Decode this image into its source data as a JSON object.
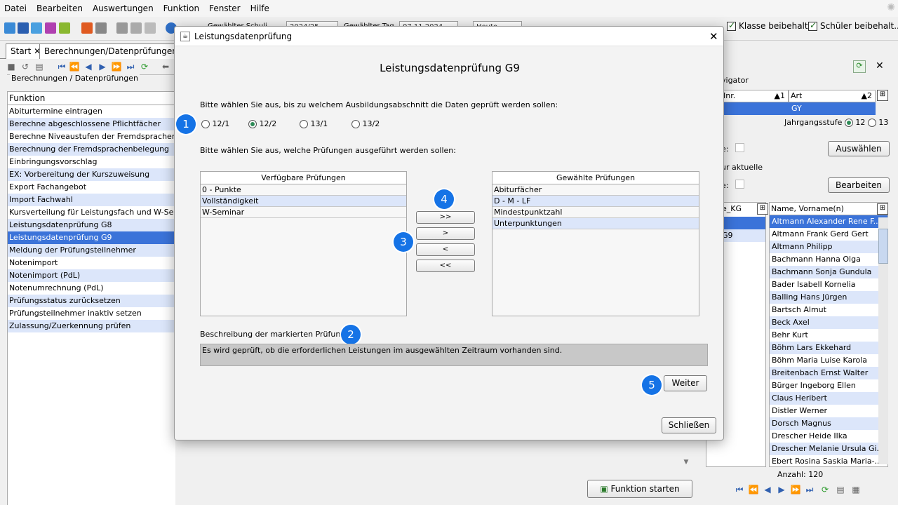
{
  "menu": [
    "Datei",
    "Bearbeiten",
    "Auswertungen",
    "Funktion",
    "Fenster",
    "Hilfe"
  ],
  "toolbar": {
    "schule_label": "Gewählter Schuli...",
    "schuljahr": "2024/25",
    "tag_label": "Gewählter Tag",
    "tag": "07.11.2024",
    "heute": "Heute",
    "klasse_beibehalten": "Klasse beibehalt...",
    "schueler_beibehalten": "Schüler beibehalt..."
  },
  "tabs": {
    "start": "Start",
    "berechnungen": "Berechnungen/Datenprüfungen"
  },
  "left": {
    "group_title": "Berechnungen / Datenprüfungen",
    "col_header": "Funktion",
    "items": [
      "Abiturtermine eintragen",
      "Berechne abgeschlossene Pflichtfächer",
      "Berechne Niveaustufen der Fremdsprachen",
      "Berechnung der Fremdsprachenbelegung",
      "Einbringungsvorschlag",
      "EX: Vorbereitung der Kurszuweisung",
      "Export Fachangebot",
      "Import Fachwahl",
      "Kursverteilung für Leistungsfach und W-Semin",
      "Leistungsdatenprüfung G8",
      "Leistungsdatenprüfung G9",
      "Meldung der Prüfungsteilnehmer",
      "Notenimport",
      "Notenimport (PdL)",
      "Notenumrechnung (PdL)",
      "Prüfungsstatus zurücksetzen",
      "Prüfungsteilnehmer inaktiv setzen",
      "Zulassung/Zuerkennung prüfen"
    ],
    "selected_index": 10,
    "start_button": "Funktion starten"
  },
  "right": {
    "navigator": "vigator",
    "col_nr": "Inr.",
    "col_nr_sort": "▲1",
    "col_art": "Art",
    "col_art_sort": "▲2",
    "art_value": "GY",
    "jahrgang_label": "Jahrgangsstufe",
    "jg_12": "12",
    "jg_13": "13",
    "auswaehlen": "Auswählen",
    "e_label": "e:",
    "ur_aktuelle": "ur aktuelle",
    "e_label2": "e:",
    "bearbeiten": "Bearbeiten",
    "col_kg": "e_KG",
    "kg_row2": "G9",
    "col_name": "Name, Vorname(n)",
    "names": [
      "Altmann Alexander Rene F...",
      "Altmann Frank Gerd Gert",
      "Altmann Philipp",
      "Bachmann Hanna Olga",
      "Bachmann Sonja Gundula",
      "Bader Isabell Kornelia",
      "Balling Hans Jürgen",
      "Bartsch Almut",
      "Beck Axel",
      "Behr Kurt",
      "Böhm Lars Ekkehard",
      "Böhm Maria Luise Karola",
      "Breitenbach Ernst Walter",
      "Bürger Ingeborg Ellen",
      "Claus Heribert",
      "Distler Werner",
      "Dorsch Magnus",
      "Drescher Heide Ilka",
      "Drescher Melanie Ursula Gi...",
      "Ebert Rosina Saskia Maria-..."
    ],
    "anzahl": "Anzahl: 120"
  },
  "dialog": {
    "window_title": "Leistungsdatenprüfung",
    "heading": "Leistungsdatenprüfung G9",
    "q1": "Bitte wählen Sie aus, bis zu welchem Ausbildungsabschnitt die Daten geprüft werden sollen:",
    "options": [
      "12/1",
      "12/2",
      "13/1",
      "13/2"
    ],
    "selected_option": 1,
    "q2": "Bitte wählen Sie aus, welche Prüfungen ausgeführt werden sollen:",
    "available_header": "Verfügbare Prüfungen",
    "available": [
      "0 - Punkte",
      "Vollständigkeit",
      "W-Seminar"
    ],
    "chosen_header": "Gewählte Prüfungen",
    "chosen": [
      "Abiturfächer",
      "D - M - LF",
      "Mindestpunktzahl",
      "Unterpunktungen"
    ],
    "btn_all_right": ">>",
    "btn_right": ">",
    "btn_left": "<",
    "btn_all_left": "<<",
    "desc_label": "Beschreibung der markierten Prüfung:",
    "desc_text": "Es wird geprüft, ob die erforderlichen Leistungen im ausgewählten Zeitraum vorhanden sind.",
    "weiter": "Weiter",
    "schliessen": "Schließen",
    "close_glyph": "✕"
  },
  "badges": [
    "1",
    "2",
    "3",
    "4",
    "5"
  ],
  "colors": {
    "selection": "#3b73d9",
    "alt_row": "#dce6fa",
    "badge": "#1573e6"
  }
}
